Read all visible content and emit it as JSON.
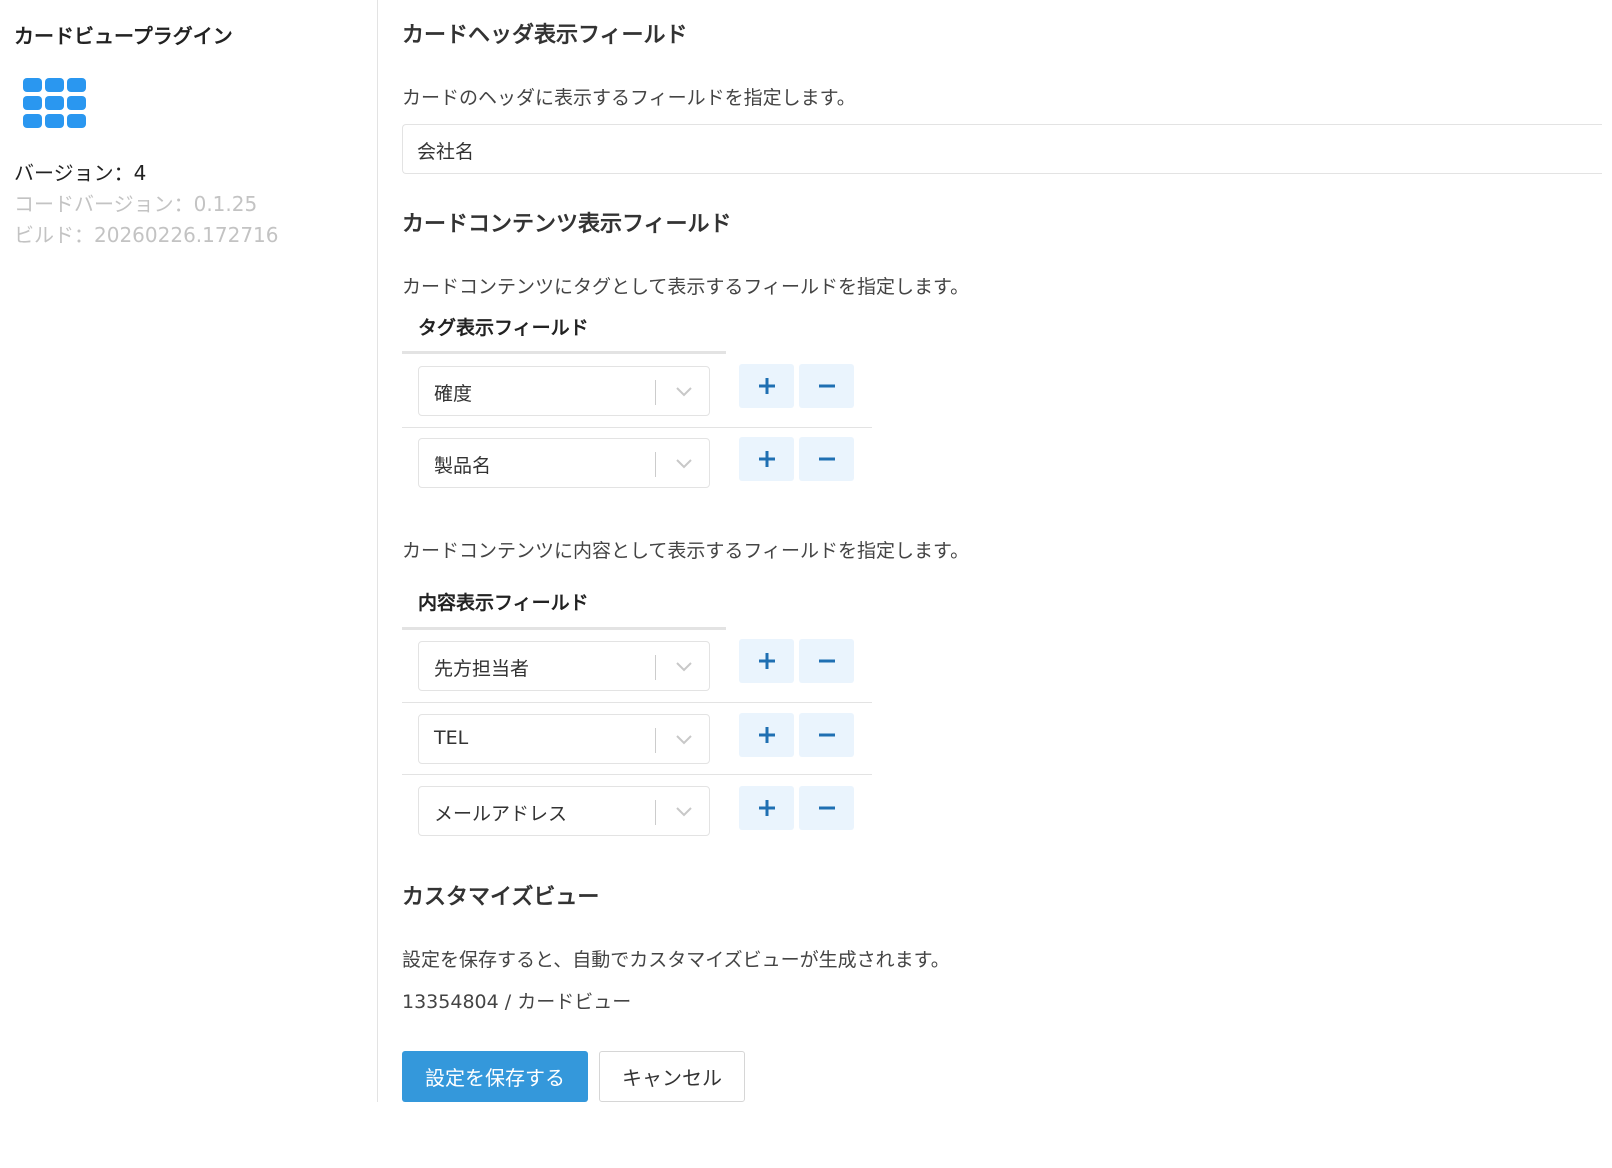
{
  "sidebar": {
    "plugin_name": "カードビュープラグイン",
    "icon": "grid-icon",
    "version": "バージョン：4",
    "code_version": "コードバージョン：0.1.25",
    "build": "ビルド：20260226.172716"
  },
  "header_section": {
    "title": "カードヘッダ表示フィールド",
    "description": "カードのヘッダに表示するフィールドを指定します。",
    "value": "会社名"
  },
  "content_section": {
    "title": "カードコンテンツ表示フィールド",
    "tag_description": "カードコンテンツにタグとして表示するフィールドを指定します。",
    "tag_table_header": "タグ表示フィールド",
    "tag_fields": [
      "確度",
      "製品名"
    ],
    "body_description": "カードコンテンツに内容として表示するフィールドを指定します。",
    "body_table_header": "内容表示フィールド",
    "body_fields": [
      "先方担当者",
      "TEL",
      "メールアドレス"
    ]
  },
  "custom_view": {
    "title": "カスタマイズビュー",
    "description": "設定を保存すると、自動でカスタマイズビューが生成されます。",
    "view_info": "13354804 / カードビュー"
  },
  "actions": {
    "save_label": "設定を保存する",
    "cancel_label": "キャンセル"
  },
  "colors": {
    "accent": "#3498db",
    "icon_blue": "#2a97f0",
    "add_remove_icon": "#1f6fb2",
    "add_remove_bg": "#eaf4fd"
  }
}
